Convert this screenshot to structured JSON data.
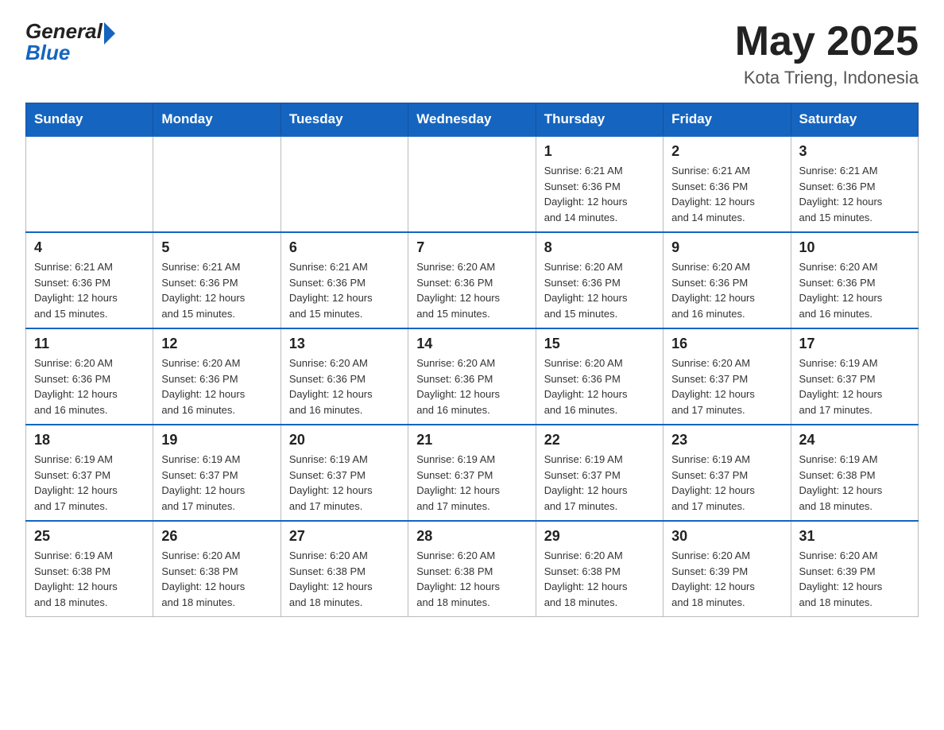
{
  "header": {
    "logo_general": "General",
    "logo_blue": "Blue",
    "month_year": "May 2025",
    "location": "Kota Trieng, Indonesia"
  },
  "weekdays": [
    "Sunday",
    "Monday",
    "Tuesday",
    "Wednesday",
    "Thursday",
    "Friday",
    "Saturday"
  ],
  "weeks": [
    [
      {
        "day": "",
        "info": ""
      },
      {
        "day": "",
        "info": ""
      },
      {
        "day": "",
        "info": ""
      },
      {
        "day": "",
        "info": ""
      },
      {
        "day": "1",
        "info": "Sunrise: 6:21 AM\nSunset: 6:36 PM\nDaylight: 12 hours\nand 14 minutes."
      },
      {
        "day": "2",
        "info": "Sunrise: 6:21 AM\nSunset: 6:36 PM\nDaylight: 12 hours\nand 14 minutes."
      },
      {
        "day": "3",
        "info": "Sunrise: 6:21 AM\nSunset: 6:36 PM\nDaylight: 12 hours\nand 15 minutes."
      }
    ],
    [
      {
        "day": "4",
        "info": "Sunrise: 6:21 AM\nSunset: 6:36 PM\nDaylight: 12 hours\nand 15 minutes."
      },
      {
        "day": "5",
        "info": "Sunrise: 6:21 AM\nSunset: 6:36 PM\nDaylight: 12 hours\nand 15 minutes."
      },
      {
        "day": "6",
        "info": "Sunrise: 6:21 AM\nSunset: 6:36 PM\nDaylight: 12 hours\nand 15 minutes."
      },
      {
        "day": "7",
        "info": "Sunrise: 6:20 AM\nSunset: 6:36 PM\nDaylight: 12 hours\nand 15 minutes."
      },
      {
        "day": "8",
        "info": "Sunrise: 6:20 AM\nSunset: 6:36 PM\nDaylight: 12 hours\nand 15 minutes."
      },
      {
        "day": "9",
        "info": "Sunrise: 6:20 AM\nSunset: 6:36 PM\nDaylight: 12 hours\nand 16 minutes."
      },
      {
        "day": "10",
        "info": "Sunrise: 6:20 AM\nSunset: 6:36 PM\nDaylight: 12 hours\nand 16 minutes."
      }
    ],
    [
      {
        "day": "11",
        "info": "Sunrise: 6:20 AM\nSunset: 6:36 PM\nDaylight: 12 hours\nand 16 minutes."
      },
      {
        "day": "12",
        "info": "Sunrise: 6:20 AM\nSunset: 6:36 PM\nDaylight: 12 hours\nand 16 minutes."
      },
      {
        "day": "13",
        "info": "Sunrise: 6:20 AM\nSunset: 6:36 PM\nDaylight: 12 hours\nand 16 minutes."
      },
      {
        "day": "14",
        "info": "Sunrise: 6:20 AM\nSunset: 6:36 PM\nDaylight: 12 hours\nand 16 minutes."
      },
      {
        "day": "15",
        "info": "Sunrise: 6:20 AM\nSunset: 6:36 PM\nDaylight: 12 hours\nand 16 minutes."
      },
      {
        "day": "16",
        "info": "Sunrise: 6:20 AM\nSunset: 6:37 PM\nDaylight: 12 hours\nand 17 minutes."
      },
      {
        "day": "17",
        "info": "Sunrise: 6:19 AM\nSunset: 6:37 PM\nDaylight: 12 hours\nand 17 minutes."
      }
    ],
    [
      {
        "day": "18",
        "info": "Sunrise: 6:19 AM\nSunset: 6:37 PM\nDaylight: 12 hours\nand 17 minutes."
      },
      {
        "day": "19",
        "info": "Sunrise: 6:19 AM\nSunset: 6:37 PM\nDaylight: 12 hours\nand 17 minutes."
      },
      {
        "day": "20",
        "info": "Sunrise: 6:19 AM\nSunset: 6:37 PM\nDaylight: 12 hours\nand 17 minutes."
      },
      {
        "day": "21",
        "info": "Sunrise: 6:19 AM\nSunset: 6:37 PM\nDaylight: 12 hours\nand 17 minutes."
      },
      {
        "day": "22",
        "info": "Sunrise: 6:19 AM\nSunset: 6:37 PM\nDaylight: 12 hours\nand 17 minutes."
      },
      {
        "day": "23",
        "info": "Sunrise: 6:19 AM\nSunset: 6:37 PM\nDaylight: 12 hours\nand 17 minutes."
      },
      {
        "day": "24",
        "info": "Sunrise: 6:19 AM\nSunset: 6:38 PM\nDaylight: 12 hours\nand 18 minutes."
      }
    ],
    [
      {
        "day": "25",
        "info": "Sunrise: 6:19 AM\nSunset: 6:38 PM\nDaylight: 12 hours\nand 18 minutes."
      },
      {
        "day": "26",
        "info": "Sunrise: 6:20 AM\nSunset: 6:38 PM\nDaylight: 12 hours\nand 18 minutes."
      },
      {
        "day": "27",
        "info": "Sunrise: 6:20 AM\nSunset: 6:38 PM\nDaylight: 12 hours\nand 18 minutes."
      },
      {
        "day": "28",
        "info": "Sunrise: 6:20 AM\nSunset: 6:38 PM\nDaylight: 12 hours\nand 18 minutes."
      },
      {
        "day": "29",
        "info": "Sunrise: 6:20 AM\nSunset: 6:38 PM\nDaylight: 12 hours\nand 18 minutes."
      },
      {
        "day": "30",
        "info": "Sunrise: 6:20 AM\nSunset: 6:39 PM\nDaylight: 12 hours\nand 18 minutes."
      },
      {
        "day": "31",
        "info": "Sunrise: 6:20 AM\nSunset: 6:39 PM\nDaylight: 12 hours\nand 18 minutes."
      }
    ]
  ]
}
